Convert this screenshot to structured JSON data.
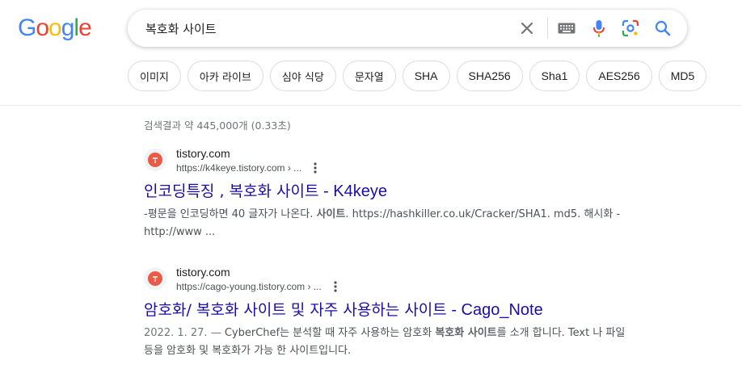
{
  "logo": {
    "letters": [
      "G",
      "o",
      "o",
      "g",
      "l",
      "e"
    ],
    "colors": [
      "#4285F4",
      "#EA4335",
      "#FBBC05",
      "#4285F4",
      "#34A853",
      "#EA4335"
    ]
  },
  "search": {
    "query": "복호화 사이트"
  },
  "chips": [
    "이미지",
    "아카 라이브",
    "심야 식당",
    "문자열",
    "SHA",
    "SHA256",
    "Sha1",
    "AES256",
    "MD5"
  ],
  "stats": "검색결과 약 445,000개 (0.33초)",
  "results": [
    {
      "site_name": "tistory.com",
      "url": "https://k4keye.tistory.com › ...",
      "title_main": "인코딩특징 , 복호화 사이트",
      "title_suffix": " - K4keye",
      "snippet": {
        "date": "",
        "p1": "-평문을 인코딩하면 40 글자가 나온다. ",
        "b1": "사이트",
        "p2": ". https://hashkiller.co.uk/Cracker/SHA1. md5. 해시화 - http://www ..."
      }
    },
    {
      "site_name": "tistory.com",
      "url": "https://cago-young.tistory.com › ...",
      "title_main": "암호화/ 복호화 사이트 및 자주 사용하는 사이트",
      "title_suffix": " - Cago_Note",
      "snippet": {
        "date": "2022. 1. 27. — ",
        "p1": "CyberChef는 분석할 때 자주 사용하는 암호화 ",
        "b1": "복호화 사이트",
        "p2": "를 소개 합니다. Text 나 파일 등을 암호화 및 복호화가 가능 한 사이트입니다."
      }
    }
  ],
  "colors": {
    "link": "#1a0dab",
    "favicon": "#eb5a46",
    "mic_blue": "#4285F4",
    "search_blue": "#4285F4"
  },
  "icons": [
    "clear-icon",
    "keyboard-icon",
    "mic-icon",
    "lens-icon",
    "search-icon",
    "more-vert-icon",
    "tistory-favicon"
  ]
}
